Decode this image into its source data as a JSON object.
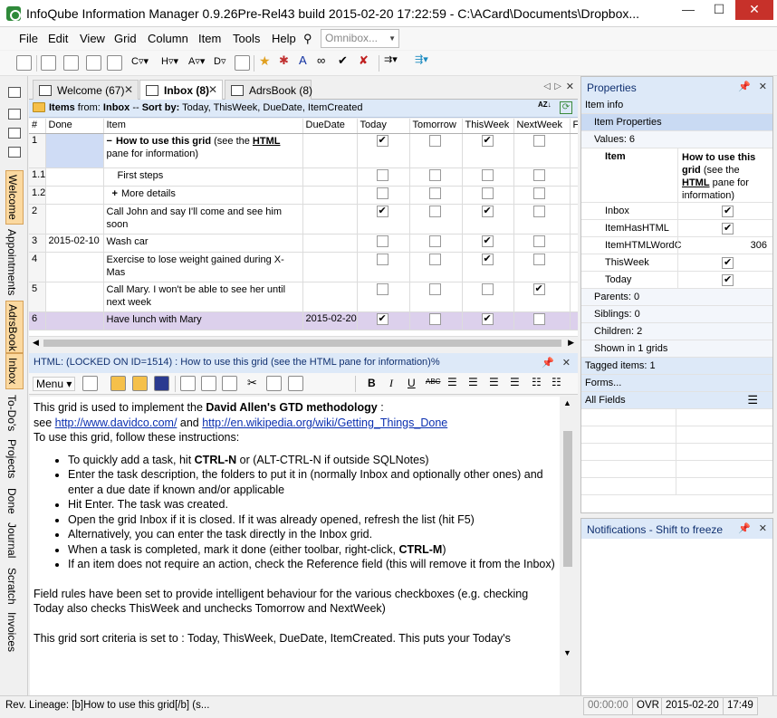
{
  "window": {
    "title": "InfoQube Information Manager 0.9.26Pre-Rel43  build 2015-02-20 17:22:59 - C:\\ACard\\Documents\\Dropbox...",
    "min": "—",
    "max": "☐",
    "close": "✕"
  },
  "menu": {
    "items": [
      "File",
      "Edit",
      "View",
      "Grid",
      "Column",
      "Item",
      "Tools",
      "Help"
    ],
    "omnibox_placeholder": "Omnibox..."
  },
  "left_tabs": [
    "Welcome",
    "Appointments",
    "AdrsBook",
    "Inbox",
    "To-Do's",
    "Projects",
    "Done",
    "Journal",
    "Scratch",
    "Invoices"
  ],
  "doc_tabs": [
    {
      "label": "Welcome (67)",
      "close": "✕"
    },
    {
      "label": "Inbox (8)",
      "close": "✕"
    },
    {
      "label": "AdrsBook (8)",
      "close": ""
    }
  ],
  "grid": {
    "header": "Items from: Inbox -- Sort by: Today, ThisWeek, DueDate, ItemCreated",
    "header_parts": {
      "a": "Items",
      "b": " from: ",
      "c": "Inbox",
      "d": " -- ",
      "e": "Sort by:",
      "f": " Today, ThisWeek, DueDate, ItemCreated"
    },
    "columns": [
      "#",
      "Done",
      "Item",
      "DueDate",
      "Today",
      "Tomorrow",
      "ThisWeek",
      "NextWeek",
      "F"
    ],
    "rows": [
      {
        "num": "1",
        "done": "",
        "item_prefix": "−",
        "item_bold": "How to use this grid",
        "item_rest": " (see the ",
        "item_link": "HTML",
        "item_rest2": " pane for information)",
        "due": "",
        "today": true,
        "tomorrow": false,
        "thisweek": true,
        "nextweek": false
      },
      {
        "num": "1.1",
        "done": "",
        "item": "First steps",
        "indent": 2,
        "due": "",
        "today": false,
        "tomorrow": false,
        "thisweek": false,
        "nextweek": false
      },
      {
        "num": "1.2",
        "done": "",
        "item_prefix": "+",
        "item": "More details",
        "indent": 1,
        "due": "",
        "today": false,
        "tomorrow": false,
        "thisweek": false,
        "nextweek": false
      },
      {
        "num": "2",
        "done": "",
        "item": "Call John and say I'll come and see him soon",
        "due": "",
        "today": true,
        "tomorrow": false,
        "thisweek": true,
        "nextweek": false
      },
      {
        "num": "3",
        "done": "2015-02-10",
        "item": "Wash car",
        "due": "",
        "today": false,
        "tomorrow": false,
        "thisweek": true,
        "nextweek": false
      },
      {
        "num": "4",
        "done": "",
        "item": "Exercise to lose weight gained during X-Mas",
        "due": "",
        "today": false,
        "tomorrow": false,
        "thisweek": true,
        "nextweek": false
      },
      {
        "num": "5",
        "done": "",
        "item": "Call Mary. I won't be able to see her until next week",
        "due": "",
        "today": false,
        "tomorrow": false,
        "thisweek": false,
        "nextweek": true
      },
      {
        "num": "6",
        "done": "",
        "item": "Have lunch with Mary",
        "due": "2015-02-20",
        "today": true,
        "tomorrow": false,
        "thisweek": true,
        "nextweek": false
      }
    ]
  },
  "html_pane": {
    "title": "HTML: (LOCKED ON ID=1514)  : How to use this grid (see the HTML pane for information)%",
    "menu_label": "Menu ▾",
    "p1_a": "This grid is used to implement the ",
    "p1_b": "David Allen's GTD methodology",
    "p1_c": " :",
    "p2_a": "see ",
    "link1": "http://www.davidco.com/",
    "p2_b": "  and ",
    "link2": "http://en.wikipedia.org/wiki/Getting_Things_Done",
    "p3": "To use this grid, follow these instructions:",
    "bullets": [
      {
        "a": "To quickly add a task, hit ",
        "b": "CTRL-N",
        "c": " or (ALT-CTRL-N if outside SQLNotes)"
      },
      {
        "a": "Enter the task description, the folders to put it in (normally Inbox and optionally other ones) and enter a due date if known and/or applicable",
        "b": "",
        "c": ""
      },
      {
        "a": "Hit Enter. The task was created.",
        "b": "",
        "c": ""
      },
      {
        "a": "Open the grid Inbox if it is closed. If it was already opened, refresh the list (hit F5)",
        "b": "",
        "c": ""
      },
      {
        "a": "Alternatively, you can enter the task directly in the Inbox grid.",
        "b": "",
        "c": ""
      },
      {
        "a": "When a task is completed, mark it done (either toolbar, right-click, ",
        "b": "CTRL-M",
        "c": ")"
      },
      {
        "a": "If an item does not require an action, check the Reference field (this will remove it from the Inbox)",
        "b": "",
        "c": ""
      }
    ],
    "p4": "Field rules have been set to provide intelligent behaviour for the various checkboxes (e.g. checking Today also checks ThisWeek and unchecks Tomorrow and NextWeek)",
    "p5": "This grid sort criteria is set to : Today, ThisWeek, DueDate, ItemCreated. This puts your Today's"
  },
  "properties": {
    "title": "Properties",
    "item_info": "Item info",
    "item_properties": "Item Properties",
    "values": "Values: 6",
    "item_label": "Item",
    "item_value_bold": "How to use this grid",
    "item_value_rest": " (see the ",
    "item_value_link": "HTML",
    "item_value_rest2": " pane for information)",
    "fields": [
      {
        "name": "Inbox",
        "type": "check",
        "value": true
      },
      {
        "name": "ItemHasHTML",
        "type": "check",
        "value": true
      },
      {
        "name": "ItemHTMLWordC",
        "type": "text",
        "value": "306"
      },
      {
        "name": "ThisWeek",
        "type": "check",
        "value": true
      },
      {
        "name": "Today",
        "type": "check",
        "value": true
      }
    ],
    "parents": "Parents: 0",
    "siblings": "Siblings: 0",
    "children": "Children: 2",
    "shown": "Shown in 1 grids",
    "tagged": "Tagged items: 1",
    "forms": "Forms...",
    "all_fields": "All Fields"
  },
  "notifications": {
    "title": "Notifications - Shift to freeze"
  },
  "status": {
    "lineage": "Rev. Lineage: [b]How to use this grid[/b] (s...",
    "time": "00:00:00",
    "mode": "OVR",
    "date": "2015-02-20",
    "clock": "17:49"
  },
  "colors": {
    "selected_row": "#dcd0ec",
    "pane_header": "#dde9f8",
    "tab_highlight": "#fbd9a0",
    "close_button": "#c7312a"
  }
}
